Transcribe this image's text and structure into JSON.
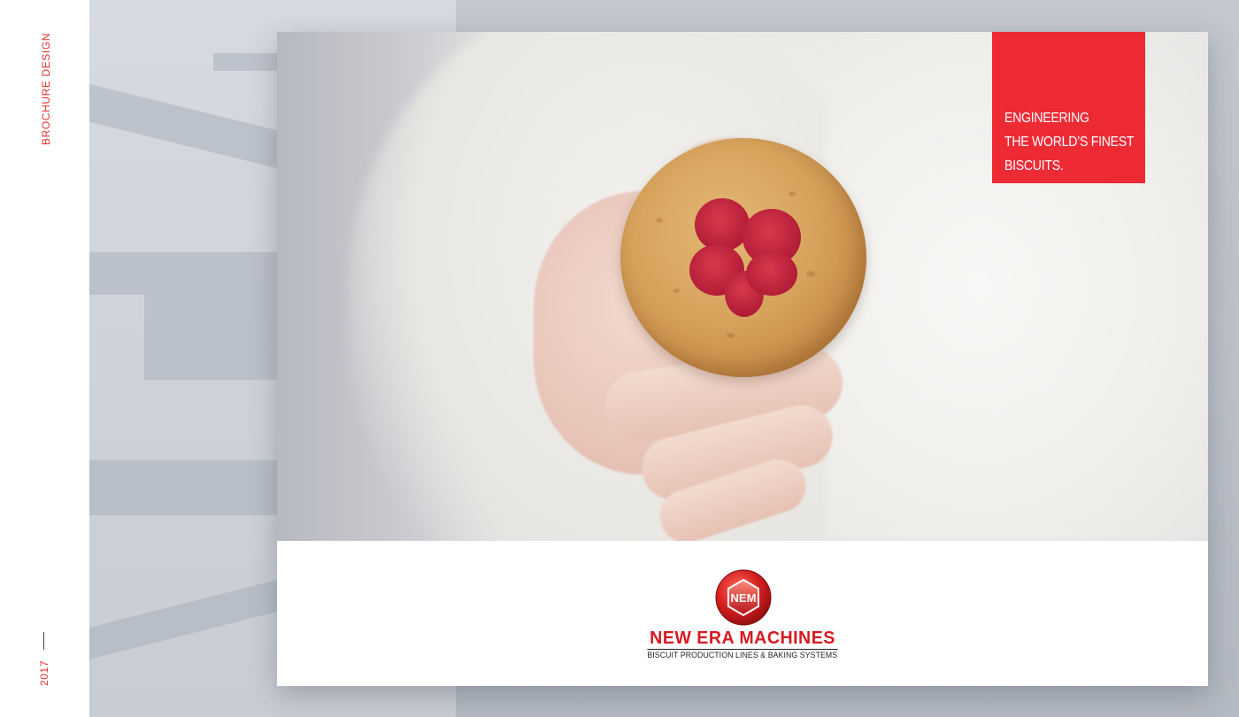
{
  "sidebar": {
    "title": "BROCHURE DESIGN",
    "year": "2017"
  },
  "tagline": {
    "lines": [
      "ENGINEERING",
      "THE WORLD’S FINEST",
      "BISCUITS."
    ]
  },
  "brand": {
    "monogram": "NEM",
    "name": "NEW ERA MACHINES",
    "tagline": "BISCUIT PRODUCTION LINES & BAKING SYSTEMS"
  },
  "colors": {
    "accent": "#ee2a35",
    "brand_red": "#d71920",
    "sidebar_text": "#e4302f",
    "year_text": "#e4302f"
  },
  "icons": {
    "logo": "nem-hexagon-logo-icon"
  }
}
